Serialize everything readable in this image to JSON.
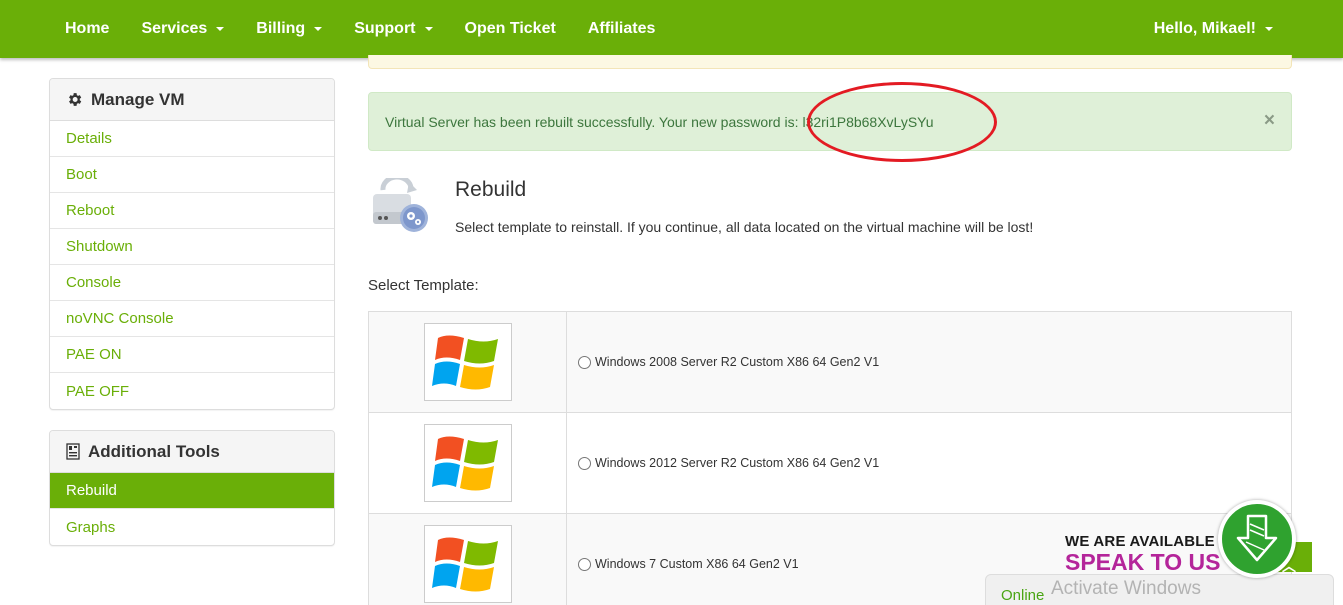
{
  "nav": {
    "items": [
      {
        "label": "Home",
        "dropdown": false
      },
      {
        "label": "Services",
        "dropdown": true
      },
      {
        "label": "Billing",
        "dropdown": true
      },
      {
        "label": "Support",
        "dropdown": true
      },
      {
        "label": "Open Ticket",
        "dropdown": false
      },
      {
        "label": "Affiliates",
        "dropdown": false
      }
    ],
    "user": "Hello, Mikael!"
  },
  "sidebar": {
    "manage_vm": {
      "title": "Manage VM",
      "icon": "gear-icon",
      "items": [
        "Details",
        "Boot",
        "Reboot",
        "Shutdown",
        "Console",
        "noVNC Console",
        "PAE ON",
        "PAE OFF"
      ]
    },
    "additional_tools": {
      "title": "Additional Tools",
      "icon": "tools-icon",
      "items": [
        "Rebuild",
        "Graphs"
      ],
      "active": "Rebuild"
    }
  },
  "alert": {
    "message": "Virtual Server has been rebuilt successfully. Your new password is:",
    "password": "l32ri1P8b68XvLySYu",
    "close": "×"
  },
  "rebuild": {
    "title": "Rebuild",
    "description": "Select template to reinstall. If you continue, all data located on the virtual machine will be lost!",
    "select_label": "Select Template:"
  },
  "templates": [
    {
      "name": "Windows 2008 Server R2 Custom X86 64 Gen2 V1",
      "icon": "windows-logo-icon"
    },
    {
      "name": "Windows 2012 Server R2 Custom X86 64 Gen2 V1",
      "icon": "windows-logo-icon"
    },
    {
      "name": "Windows 7 Custom X86 64 Gen2 V1",
      "icon": "windows-logo-icon"
    }
  ],
  "chat": {
    "available": "WE ARE AVAILABLE",
    "speak": "SPEAK TO US",
    "status": "Online",
    "watermark": "Activate Windows"
  },
  "colors": {
    "brand_green": "#6aaf08",
    "alert_bg": "#dff0d8",
    "alert_text": "#3c763d",
    "annotation_red": "#e31b23",
    "chat_magenta": "#b4259a"
  }
}
